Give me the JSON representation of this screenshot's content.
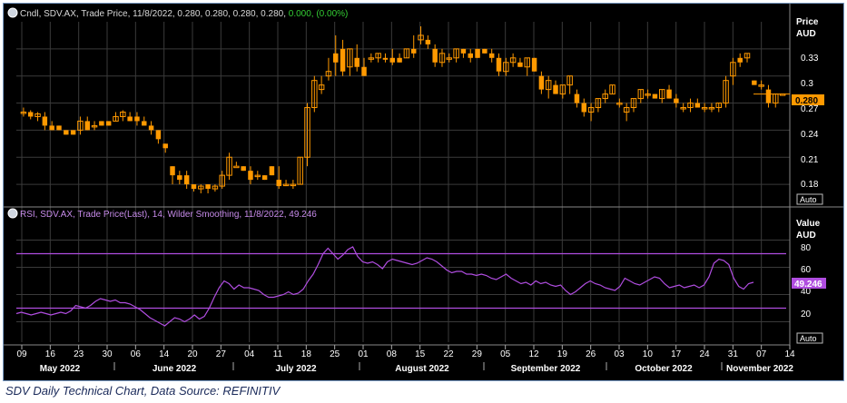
{
  "caption": "SDV Daily Technical Chart, Data Source: REFINITIV",
  "colors": {
    "background": "#000000",
    "grid": "#3a3a3a",
    "candle": "#ff9900",
    "rsi": "#b04de0",
    "header_text": "#d8d8d8",
    "change_text": "#33cc33"
  },
  "price_panel": {
    "header": {
      "icon": "collapse-icon",
      "title": "Cndl, SDV.AX, Trade Price, 11/8/2022, 0.280, 0.280, 0.280, 0.280,",
      "change": "0.000, (0.00%)"
    },
    "axis_title": [
      "Price",
      "AUD"
    ],
    "ticks": [
      "0.33",
      "0.3",
      "0.27",
      "0.24",
      "0.21",
      "0.18"
    ],
    "last_label": "0.280",
    "auto_label": "Auto"
  },
  "rsi_panel": {
    "header": {
      "icon": "collapse-icon",
      "title": "RSI, SDV.AX, Trade Price(Last), 14, Wilder Smoothing, 11/8/2022, 49.246"
    },
    "axis_title": [
      "Value",
      "AUD"
    ],
    "ticks": [
      "80",
      "60",
      "40",
      "20"
    ],
    "last_label": "49.246",
    "auto_label": "Auto"
  },
  "x_axis": {
    "days": [
      "09",
      "16",
      "23",
      "30",
      "06",
      "14",
      "20",
      "27",
      "04",
      "11",
      "18",
      "25",
      "01",
      "08",
      "15",
      "22",
      "29",
      "05",
      "12",
      "19",
      "26",
      "03",
      "10",
      "17",
      "24",
      "31",
      "07",
      "14"
    ],
    "months": [
      "May 2022",
      "June 2022",
      "July 2022",
      "August 2022",
      "September 2022",
      "October 2022",
      "November 2022"
    ]
  },
  "chart_data": [
    {
      "type": "candlestick",
      "title": "Cndl, SDV.AX, Trade Price, 11/8/2022",
      "ylabel": "Price AUD",
      "ylim": [
        0.165,
        0.36
      ],
      "approx_ohlc_price_series": [
        [
          0.26,
          0.265,
          0.255,
          0.26
        ],
        [
          0.26,
          0.262,
          0.252,
          0.255
        ],
        [
          0.255,
          0.26,
          0.25,
          0.258
        ],
        [
          0.255,
          0.26,
          0.24,
          0.245
        ],
        [
          0.245,
          0.25,
          0.24,
          0.24
        ],
        [
          0.245,
          0.245,
          0.24,
          0.24
        ],
        [
          0.24,
          0.24,
          0.235,
          0.235
        ],
        [
          0.24,
          0.24,
          0.235,
          0.235
        ],
        [
          0.24,
          0.255,
          0.235,
          0.25
        ],
        [
          0.25,
          0.255,
          0.24,
          0.24
        ],
        [
          0.245,
          0.25,
          0.24,
          0.245
        ],
        [
          0.25,
          0.25,
          0.245,
          0.245
        ],
        [
          0.25,
          0.25,
          0.245,
          0.245
        ],
        [
          0.25,
          0.26,
          0.25,
          0.255
        ],
        [
          0.255,
          0.262,
          0.25,
          0.26
        ],
        [
          0.255,
          0.26,
          0.25,
          0.25
        ],
        [
          0.255,
          0.26,
          0.245,
          0.25
        ],
        [
          0.25,
          0.255,
          0.245,
          0.245
        ],
        [
          0.245,
          0.25,
          0.235,
          0.24
        ],
        [
          0.24,
          0.24,
          0.225,
          0.23
        ],
        [
          0.225,
          0.225,
          0.215,
          0.22
        ],
        [
          0.2,
          0.2,
          0.18,
          0.19
        ],
        [
          0.19,
          0.195,
          0.18,
          0.185
        ],
        [
          0.19,
          0.195,
          0.175,
          0.18
        ],
        [
          0.18,
          0.18,
          0.172,
          0.175
        ],
        [
          0.175,
          0.18,
          0.17,
          0.178
        ],
        [
          0.18,
          0.18,
          0.17,
          0.175
        ],
        [
          0.175,
          0.18,
          0.172,
          0.178
        ],
        [
          0.178,
          0.195,
          0.175,
          0.19
        ],
        [
          0.19,
          0.215,
          0.185,
          0.21
        ],
        [
          0.2,
          0.205,
          0.2,
          0.2
        ],
        [
          0.2,
          0.2,
          0.195,
          0.195
        ],
        [
          0.195,
          0.2,
          0.18,
          0.185
        ],
        [
          0.19,
          0.195,
          0.185,
          0.19
        ],
        [
          0.19,
          0.19,
          0.185,
          0.185
        ],
        [
          0.2,
          0.2,
          0.19,
          0.19
        ],
        [
          0.185,
          0.2,
          0.175,
          0.178
        ],
        [
          0.18,
          0.185,
          0.178,
          0.18
        ],
        [
          0.18,
          0.185,
          0.175,
          0.18
        ],
        [
          0.18,
          0.21,
          0.18,
          0.21
        ],
        [
          0.21,
          0.27,
          0.2,
          0.265
        ],
        [
          0.265,
          0.3,
          0.26,
          0.295
        ],
        [
          0.285,
          0.3,
          0.28,
          0.29
        ],
        [
          0.3,
          0.32,
          0.295,
          0.305
        ],
        [
          0.325,
          0.345,
          0.3,
          0.315
        ],
        [
          0.33,
          0.34,
          0.3,
          0.305
        ],
        [
          0.31,
          0.33,
          0.3,
          0.33
        ],
        [
          0.32,
          0.335,
          0.305,
          0.31
        ],
        [
          0.31,
          0.32,
          0.3,
          0.3
        ],
        [
          0.32,
          0.325,
          0.315,
          0.32
        ],
        [
          0.32,
          0.325,
          0.315,
          0.325
        ],
        [
          0.32,
          0.325,
          0.315,
          0.318
        ],
        [
          0.32,
          0.33,
          0.312,
          0.315
        ],
        [
          0.32,
          0.325,
          0.315,
          0.315
        ],
        [
          0.32,
          0.33,
          0.32,
          0.33
        ],
        [
          0.33,
          0.345,
          0.32,
          0.325
        ],
        [
          0.34,
          0.355,
          0.335,
          0.345
        ],
        [
          0.34,
          0.345,
          0.33,
          0.335
        ],
        [
          0.33,
          0.335,
          0.31,
          0.315
        ],
        [
          0.315,
          0.33,
          0.31,
          0.325
        ],
        [
          0.32,
          0.325,
          0.315,
          0.32
        ],
        [
          0.32,
          0.33,
          0.315,
          0.33
        ],
        [
          0.33,
          0.33,
          0.32,
          0.325
        ],
        [
          0.325,
          0.33,
          0.315,
          0.32
        ],
        [
          0.33,
          0.33,
          0.32,
          0.32
        ],
        [
          0.33,
          0.33,
          0.325,
          0.325
        ],
        [
          0.325,
          0.33,
          0.315,
          0.32
        ],
        [
          0.32,
          0.325,
          0.3,
          0.305
        ],
        [
          0.305,
          0.32,
          0.3,
          0.315
        ],
        [
          0.315,
          0.325,
          0.31,
          0.32
        ],
        [
          0.315,
          0.32,
          0.31,
          0.31
        ],
        [
          0.31,
          0.32,
          0.3,
          0.32
        ],
        [
          0.32,
          0.32,
          0.305,
          0.305
        ],
        [
          0.3,
          0.305,
          0.28,
          0.285
        ],
        [
          0.285,
          0.3,
          0.275,
          0.295
        ],
        [
          0.29,
          0.295,
          0.28,
          0.28
        ],
        [
          0.28,
          0.29,
          0.275,
          0.29
        ],
        [
          0.29,
          0.3,
          0.28,
          0.3
        ],
        [
          0.28,
          0.285,
          0.265,
          0.27
        ],
        [
          0.27,
          0.275,
          0.255,
          0.26
        ],
        [
          0.26,
          0.27,
          0.25,
          0.265
        ],
        [
          0.265,
          0.275,
          0.26,
          0.275
        ],
        [
          0.275,
          0.285,
          0.27,
          0.28
        ],
        [
          0.28,
          0.29,
          0.28,
          0.29
        ],
        [
          0.27,
          0.275,
          0.265,
          0.27
        ],
        [
          0.26,
          0.27,
          0.25,
          0.265
        ],
        [
          0.265,
          0.275,
          0.26,
          0.275
        ],
        [
          0.275,
          0.285,
          0.27,
          0.285
        ],
        [
          0.28,
          0.285,
          0.275,
          0.28
        ],
        [
          0.28,
          0.28,
          0.275,
          0.275
        ],
        [
          0.275,
          0.285,
          0.27,
          0.285
        ],
        [
          0.285,
          0.29,
          0.275,
          0.275
        ],
        [
          0.275,
          0.28,
          0.265,
          0.27
        ],
        [
          0.265,
          0.27,
          0.26,
          0.265
        ],
        [
          0.265,
          0.275,
          0.26,
          0.27
        ],
        [
          0.27,
          0.275,
          0.265,
          0.265
        ],
        [
          0.265,
          0.27,
          0.26,
          0.265
        ],
        [
          0.265,
          0.27,
          0.26,
          0.265
        ],
        [
          0.265,
          0.27,
          0.26,
          0.27
        ],
        [
          0.27,
          0.3,
          0.265,
          0.295
        ],
        [
          0.3,
          0.32,
          0.29,
          0.315
        ],
        [
          0.32,
          0.325,
          0.31,
          0.315
        ],
        [
          0.32,
          0.325,
          0.315,
          0.325
        ],
        [
          0.295,
          0.295,
          0.29,
          0.29
        ],
        [
          0.29,
          0.295,
          0.285,
          0.29
        ],
        [
          0.285,
          0.29,
          0.265,
          0.27
        ],
        [
          0.27,
          0.28,
          0.265,
          0.28
        ],
        [
          0.28,
          0.28,
          0.28,
          0.28
        ]
      ]
    },
    {
      "type": "line",
      "title": "RSI, SDV.AX, Trade Price(Last), 14, Wilder Smoothing, 11/8/2022",
      "ylabel": "Value AUD",
      "ylim": [
        5,
        95
      ],
      "reference_lines": [
        70,
        30
      ],
      "values": [
        26,
        27,
        26,
        25,
        26,
        27,
        26,
        25,
        26,
        27,
        26,
        28,
        32,
        31,
        30,
        32,
        35,
        37,
        36,
        35,
        36,
        34,
        34,
        33,
        31,
        29,
        26,
        23,
        21,
        19,
        17,
        20,
        23,
        22,
        20,
        22,
        25,
        22,
        24,
        30,
        38,
        45,
        50,
        48,
        44,
        47,
        45,
        45,
        44,
        43,
        40,
        38,
        38,
        39,
        40,
        42,
        40,
        41,
        44,
        50,
        55,
        62,
        70,
        74,
        70,
        66,
        69,
        73,
        75,
        68,
        64,
        63,
        64,
        62,
        59,
        64,
        66,
        65,
        64,
        63,
        62,
        63,
        65,
        67,
        66,
        64,
        61,
        58,
        56,
        57,
        57,
        55,
        55,
        54,
        55,
        54,
        52,
        51,
        53,
        55,
        52,
        50,
        48,
        49,
        47,
        50,
        48,
        49,
        47,
        46,
        47,
        43,
        40,
        42,
        45,
        48,
        50,
        48,
        47,
        45,
        44,
        43,
        46,
        52,
        50,
        48,
        47,
        49,
        51,
        53,
        52,
        48,
        45,
        46,
        47,
        45,
        46,
        47,
        45,
        47,
        53,
        63,
        66,
        65,
        62,
        52,
        46,
        44,
        48,
        49
      ]
    }
  ]
}
